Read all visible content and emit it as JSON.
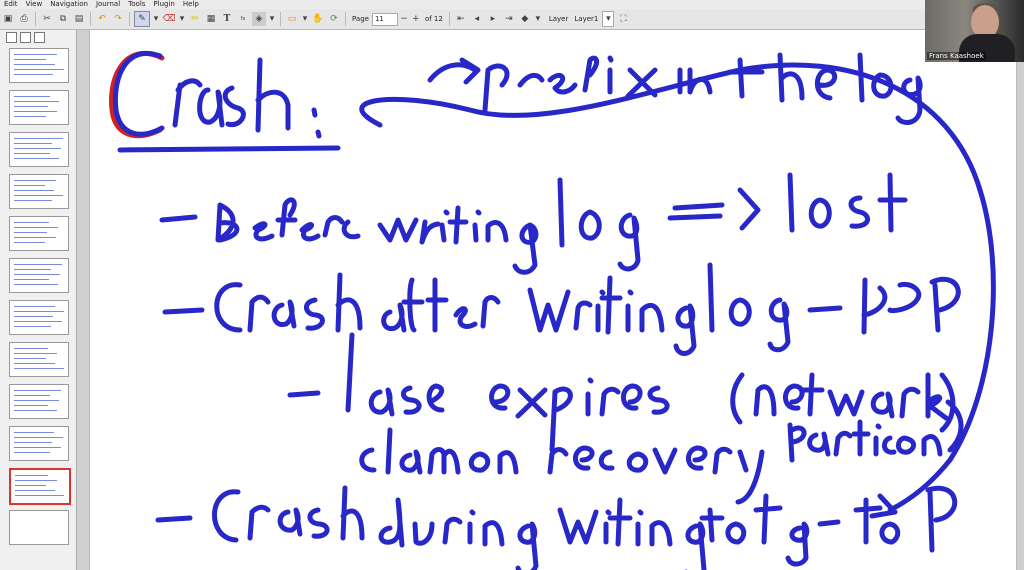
{
  "menu": [
    "Edit",
    "View",
    "Navigation",
    "Journal",
    "Tools",
    "Plugin",
    "Help"
  ],
  "toolbar": {
    "page_label": "Page",
    "page_value": "11",
    "page_of": "of 12",
    "layer_label": "Layer",
    "layer_value": "Layer1"
  },
  "video": {
    "participant_name": "Frans Kaashoek"
  },
  "ink_color": "#2828c8",
  "accent_red": "#d42020",
  "note": {
    "title": "Crash:",
    "arrow_note": "prefix in the log",
    "line1": "- Before writing log → lost",
    "line2": "- Crash after writing log to P",
    "line3": "- lease expires",
    "line3b": "(network partition)",
    "line4": "clamon recovery",
    "line5": "- Crash during writing to log to P"
  },
  "thumbnails": 12,
  "active_thumbnail": 11
}
